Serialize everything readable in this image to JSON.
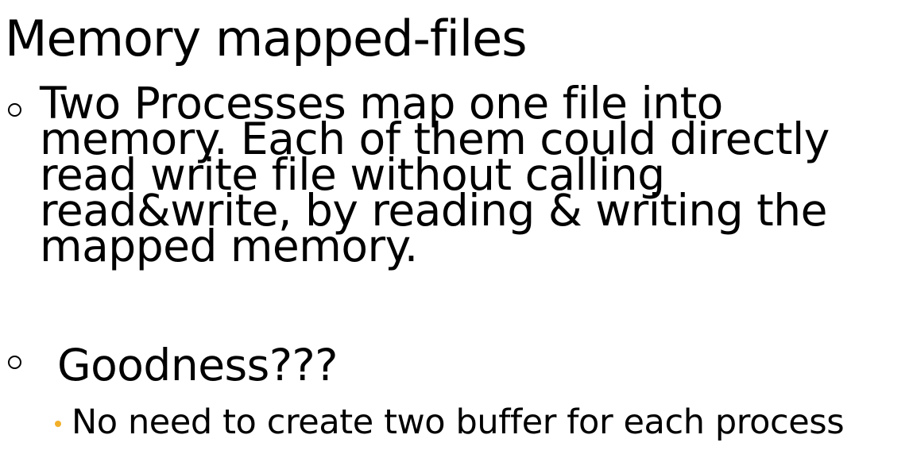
{
  "slide": {
    "title": "Memory mapped-files",
    "bullets": [
      {
        "lines": [
          "Two Processes map one file into",
          "memory. Each of them could directly",
          "read write file without calling",
          "read&write, by reading & writing the",
          "mapped memory."
        ]
      },
      {
        "text": " Goodness???",
        "sub_bullets": [
          "No need to create two buffer for each process"
        ]
      }
    ],
    "colors": {
      "text": "#000000",
      "background": "#ffffff",
      "sub_bullet_marker": "#f2b02a"
    },
    "icons": {
      "level1_marker": "hollow-circle-bullet-icon",
      "level2_marker": "filled-dot-bullet-icon"
    }
  }
}
